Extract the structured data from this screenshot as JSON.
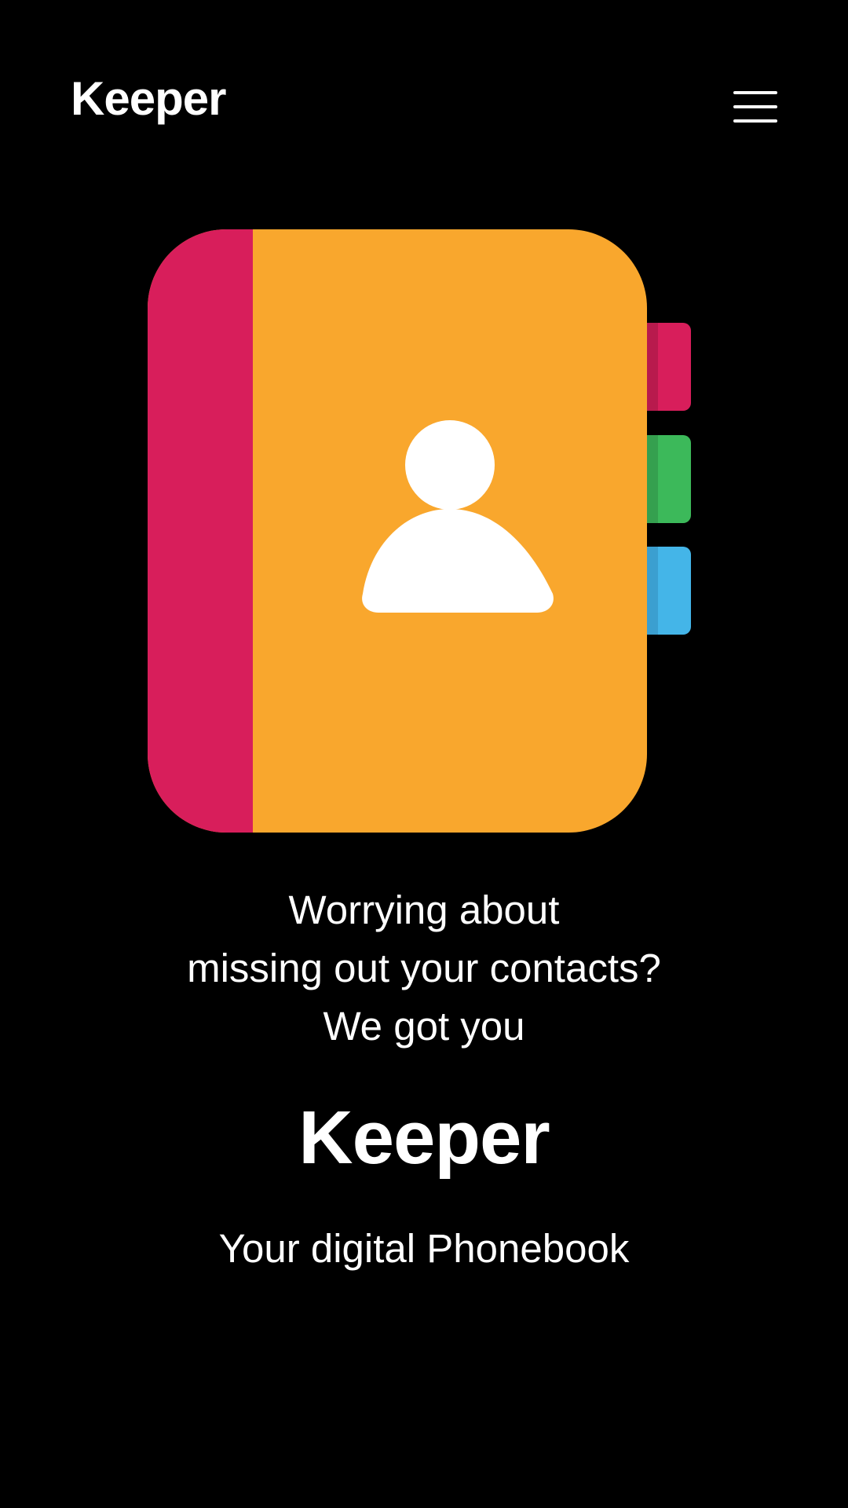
{
  "app_bar": {
    "brand": "Keeper",
    "menu_icon": "hamburger-menu-icon"
  },
  "illustration": {
    "icon": "contact-book-icon",
    "colors": {
      "spine": "#D81E5B",
      "cover": "#F9A72D",
      "tab_top": "#D81E5B",
      "tab_middle": "#3CB95A",
      "tab_bottom": "#44B5E8",
      "person": "#FFFFFF"
    }
  },
  "hero": {
    "tagline_lines": [
      "Worrying about",
      "missing out your contacts?",
      "We got you"
    ],
    "title": "Keeper",
    "subtitle": "Your digital Phonebook"
  }
}
